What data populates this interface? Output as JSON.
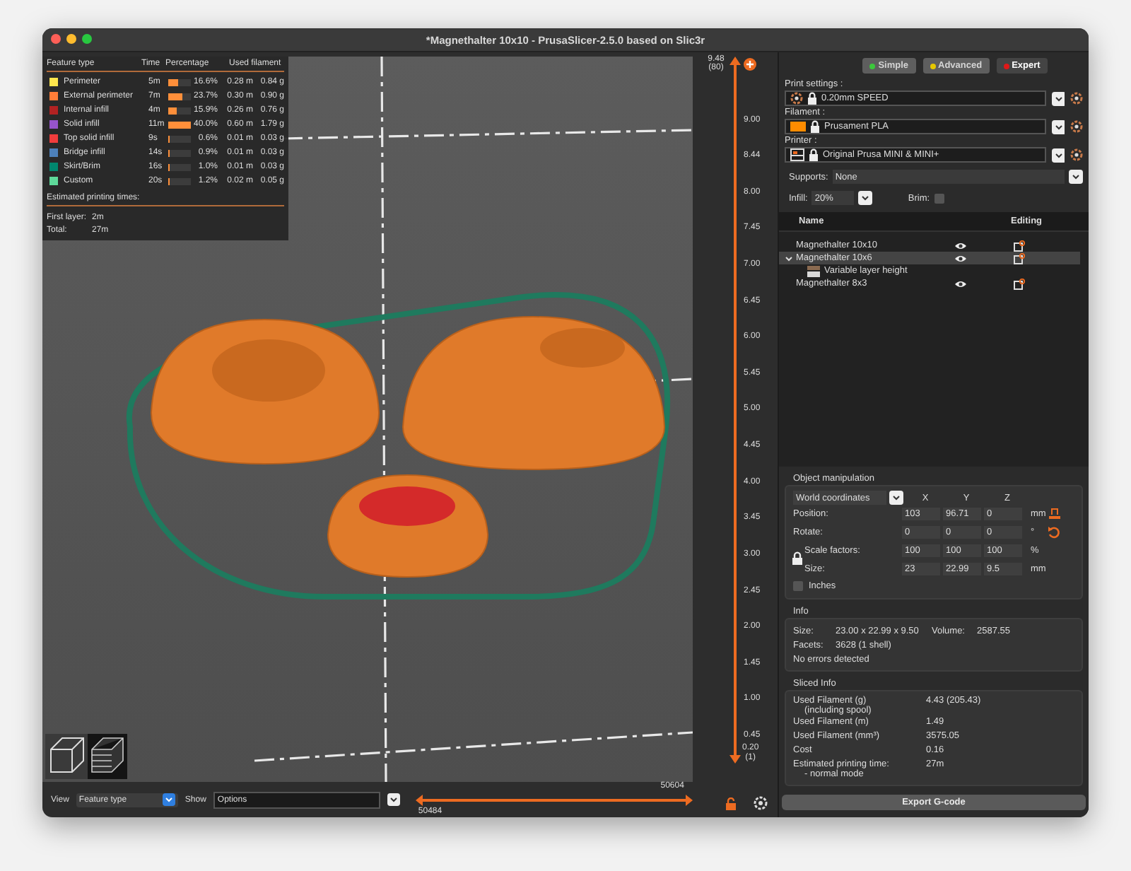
{
  "window": {
    "title": "*Magnethalter 10x10 - PrusaSlicer-2.5.0 based on Slic3r"
  },
  "legend": {
    "columns": [
      "Feature type",
      "Time",
      "Percentage",
      "Used filament"
    ],
    "rows": [
      {
        "color": "#ffe64d",
        "name": "Perimeter",
        "time": "5m",
        "level": 0.42,
        "percentage": "16.6%",
        "meters": "0.28 m",
        "grams": "0.84 g"
      },
      {
        "color": "#ff7d38",
        "name": "External perimeter",
        "time": "7m",
        "level": 0.6,
        "percentage": "23.7%",
        "meters": "0.30 m",
        "grams": "0.90 g"
      },
      {
        "color": "#b22222",
        "name": "Internal infill",
        "time": "4m",
        "level": 0.4,
        "percentage": "15.9%",
        "meters": "0.26 m",
        "grams": "0.76 g"
      },
      {
        "color": "#9654cc",
        "name": "Solid infill",
        "time": "11m",
        "level": 1,
        "percentage": "40.0%",
        "meters": "0.60 m",
        "grams": "1.79 g"
      },
      {
        "color": "#f03c3c",
        "name": "Top solid infill",
        "time": "9s",
        "level": 0.02,
        "percentage": "0.6%",
        "meters": "0.01 m",
        "grams": "0.03 g"
      },
      {
        "color": "#4d80ba",
        "name": "Bridge infill",
        "time": "14s",
        "level": 0.03,
        "percentage": "0.9%",
        "meters": "0.01 m",
        "grams": "0.03 g"
      },
      {
        "color": "#00876e",
        "name": "Skirt/Brim",
        "time": "16s",
        "level": 0.03,
        "percentage": "1.0%",
        "meters": "0.01 m",
        "grams": "0.03 g"
      },
      {
        "color": "#5ed99a",
        "name": "Custom",
        "time": "20s",
        "level": 0.03,
        "percentage": "1.2%",
        "meters": "0.02 m",
        "grams": "0.05 g"
      }
    ],
    "estimated_title": "Estimated printing times:",
    "times": [
      {
        "label": "First layer:",
        "value": "2m"
      },
      {
        "label": "Total:",
        "value": "27m"
      }
    ]
  },
  "layer_slider": {
    "top_value": "9.48",
    "top_layer": "(80)",
    "ticks": [
      "9.00",
      "8.44",
      "8.00",
      "7.45",
      "7.00",
      "6.45",
      "6.00",
      "5.45",
      "5.00",
      "4.45",
      "4.00",
      "3.45",
      "3.00",
      "2.45",
      "2.00",
      "1.45",
      "1.00",
      "0.45"
    ],
    "bottom_value": "0.20",
    "bottom_layer": "(1)"
  },
  "bottom_bar": {
    "view_label": "View",
    "view_value": "Feature type",
    "show_label": "Show",
    "show_value": "Options",
    "move_end": "50604",
    "move_start": "50484"
  },
  "modes": [
    {
      "label": "Simple",
      "color": "#3cc83c",
      "selected": false
    },
    {
      "label": "Advanced",
      "color": "#e6c800",
      "selected": false
    },
    {
      "label": "Expert",
      "color": "#e01818",
      "selected": true
    }
  ],
  "presets": [
    {
      "kind": "print",
      "label": "Print settings :",
      "value": "0.20mm SPEED"
    },
    {
      "kind": "filament",
      "label": "Filament :",
      "value": "Prusament PLA",
      "color": "#ff8c00"
    },
    {
      "kind": "printer",
      "label": "Printer :",
      "value": "Original Prusa MINI & MINI+"
    }
  ],
  "supports": {
    "label": "Supports:",
    "value": "None"
  },
  "infill": {
    "label": "Infill:",
    "value": "20%"
  },
  "brim": {
    "label": "Brim:",
    "checked": false
  },
  "objects": {
    "columns": [
      "Name",
      "Editing"
    ],
    "items": [
      {
        "name": "Magnethalter 10x10",
        "selected": false
      },
      {
        "name": "Magnethalter 10x6",
        "selected": true,
        "expanded": true,
        "children": [
          {
            "name": "Variable layer height",
            "selected": false
          }
        ]
      },
      {
        "name": "Magnethalter 8x3",
        "selected": false
      }
    ]
  },
  "object_manipulation": {
    "title": "Object manipulation",
    "coordinates": "World coordinates",
    "axes": [
      "X",
      "Y",
      "Z"
    ],
    "rows": [
      {
        "kind": "position",
        "label": "Position:",
        "values": [
          "103",
          "96.71",
          "0"
        ],
        "unit": "mm"
      },
      {
        "kind": "rotate",
        "label": "Rotate:",
        "values": [
          "0",
          "0",
          "0"
        ],
        "unit": "°"
      },
      {
        "kind": "scale",
        "label": "Scale factors:",
        "values": [
          "100",
          "100",
          "100"
        ],
        "unit": "%"
      },
      {
        "kind": "size",
        "label": "Size:",
        "values": [
          "23",
          "22.99",
          "9.5"
        ],
        "unit": "mm"
      }
    ],
    "inches": {
      "label": "Inches",
      "checked": false
    }
  },
  "info": {
    "title": "Info",
    "size_label": "Size:",
    "size": "23.00 x 22.99 x 9.50",
    "volume_label": "Volume:",
    "volume": "2587.55",
    "facets_label": "Facets:",
    "facets": "3628 (1 shell)",
    "status": "No errors detected"
  },
  "sliced_info": {
    "title": "Sliced Info",
    "rows": [
      {
        "label": "Used Filament (g)",
        "sublabel": "(including spool)",
        "value": "4.43 (205.43)"
      },
      {
        "label": "Used Filament (m)",
        "value": "1.49"
      },
      {
        "label": "Used Filament (mm³)",
        "value": "3575.05"
      },
      {
        "label": "Cost",
        "value": "0.16"
      },
      {
        "label": "Estimated printing time:",
        "sublabel": "- normal mode",
        "value": "27m"
      }
    ]
  },
  "export_button": "Export G-code"
}
